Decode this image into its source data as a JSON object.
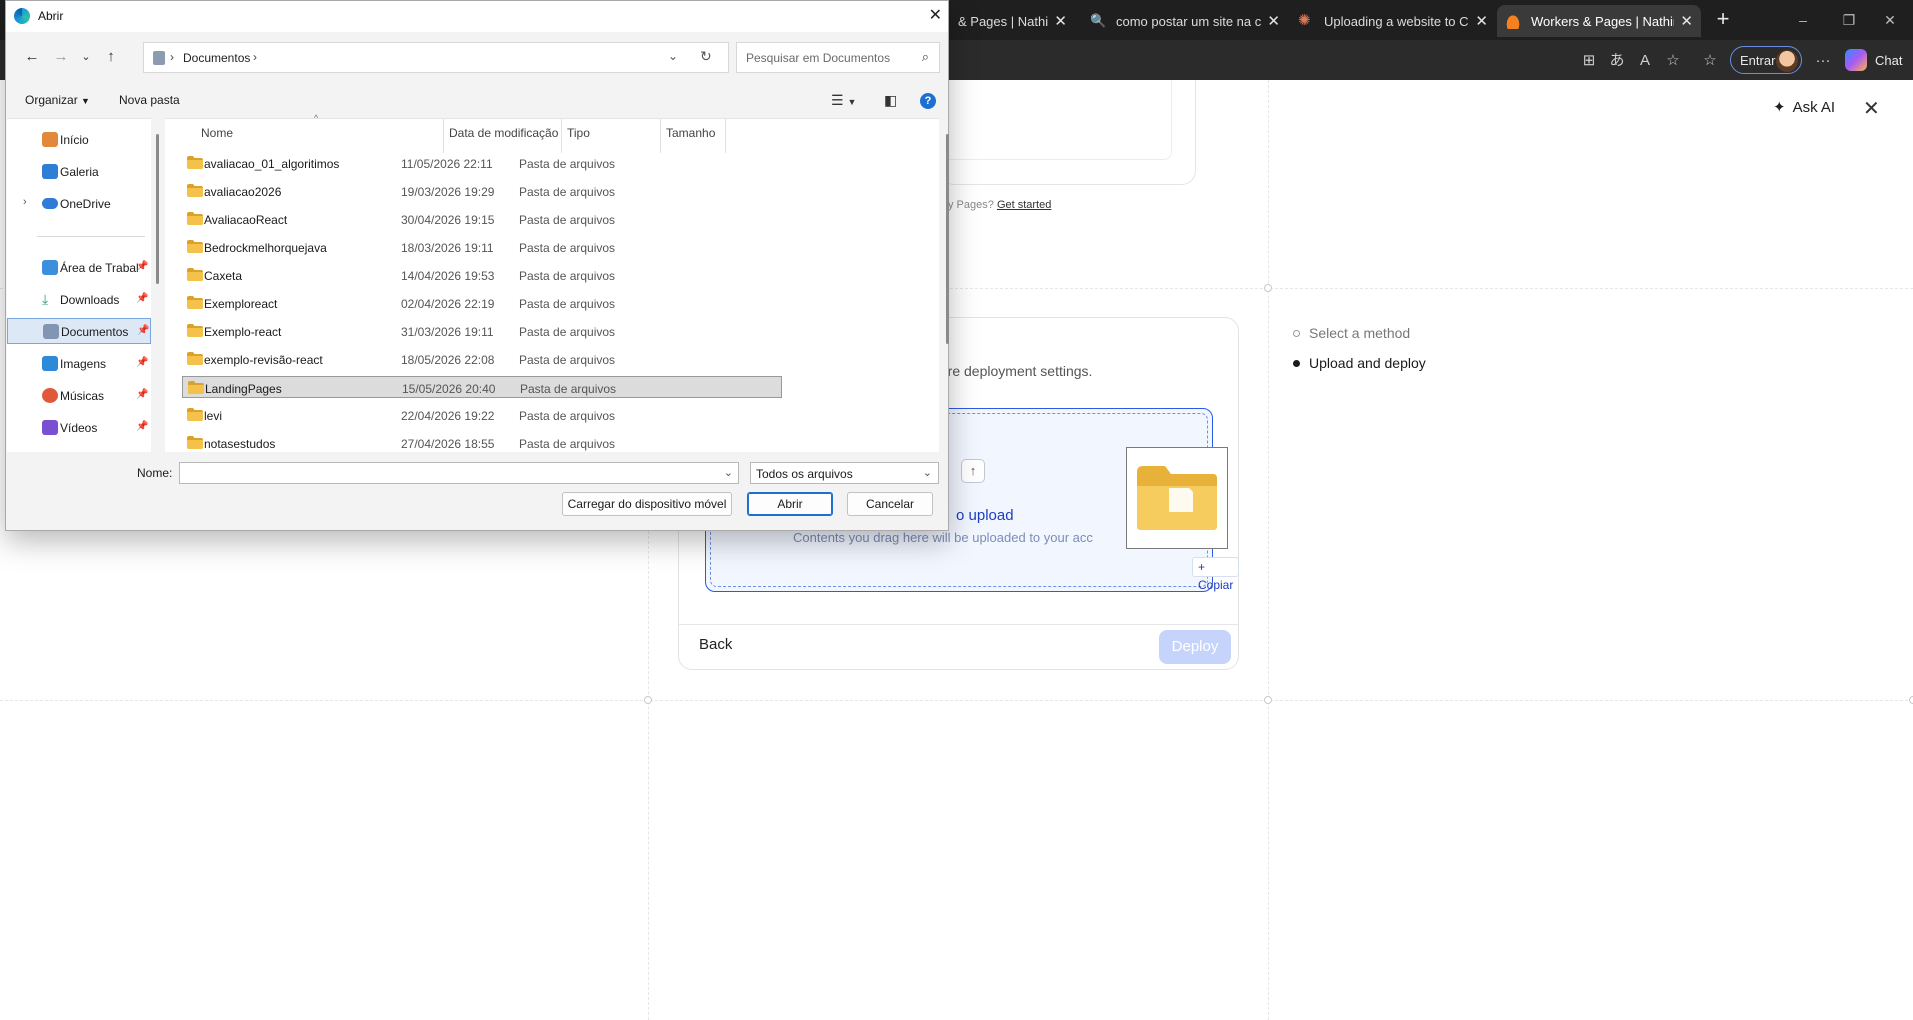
{
  "browser": {
    "tabs": [
      {
        "title": "& Pages | Nathiman",
        "active": false
      },
      {
        "title": "como postar um site na clou",
        "active": false
      },
      {
        "title": "Uploading a website to Clou",
        "active": false
      },
      {
        "title": "Workers & Pages | Nathiman",
        "active": true
      }
    ],
    "new_tab_icon": "plus-icon",
    "signin_label": "Entrar",
    "chat_label": "Chat",
    "more_label": "···"
  },
  "page": {
    "ask_ai_label": "Ask AI",
    "pages_note_prefix": "y Pages?",
    "pages_note_link": "Get started",
    "deploy_header_partial": "igure deployment settings.",
    "drop_title_partial": "o upload",
    "drop_subtitle": "Contents you drag here will be uploaded to your acc",
    "copy_badge": "+ Copiar",
    "back_label": "Back",
    "deploy_label": "Deploy",
    "steps": [
      {
        "label": "Select a method",
        "state": "pending"
      },
      {
        "label": "Upload and deploy",
        "state": "current"
      }
    ],
    "accent_color": "#1d3fbf"
  },
  "dialog": {
    "title": "Abrir",
    "path": "Documentos",
    "search_placeholder": "Pesquisar em Documentos",
    "organize_label": "Organizar",
    "new_folder_label": "Nova pasta",
    "columns": {
      "name": "Nome",
      "date": "Data de modificação",
      "type": "Tipo",
      "size": "Tamanho"
    },
    "nav": {
      "inicio": "Início",
      "galeria": "Galeria",
      "onedrive": "OneDrive",
      "desktop": "Área de Trabalho",
      "downloads": "Downloads",
      "documentos": "Documentos",
      "imagens": "Imagens",
      "musicas": "Músicas",
      "videos": "Vídeos"
    },
    "files": [
      {
        "name": "avaliacao_01_algoritimos",
        "date": "11/05/2026 22:11",
        "type": "Pasta de arquivos"
      },
      {
        "name": "avaliacao2026",
        "date": "19/03/2026 19:29",
        "type": "Pasta de arquivos"
      },
      {
        "name": "AvaliacaoReact",
        "date": "30/04/2026 19:15",
        "type": "Pasta de arquivos"
      },
      {
        "name": "Bedrockmelhorquejava",
        "date": "18/03/2026 19:11",
        "type": "Pasta de arquivos"
      },
      {
        "name": "Caxeta",
        "date": "14/04/2026 19:53",
        "type": "Pasta de arquivos"
      },
      {
        "name": "Exemploreact",
        "date": "02/04/2026 22:19",
        "type": "Pasta de arquivos"
      },
      {
        "name": "Exemplo-react",
        "date": "31/03/2026 19:11",
        "type": "Pasta de arquivos"
      },
      {
        "name": "exemplo-revisão-react",
        "date": "18/05/2026 22:08",
        "type": "Pasta de arquivos"
      },
      {
        "name": "LandingPages",
        "date": "15/05/2026 20:40",
        "type": "Pasta de arquivos",
        "selected": true
      },
      {
        "name": "levi",
        "date": "22/04/2026 19:22",
        "type": "Pasta de arquivos"
      },
      {
        "name": "notasestudos",
        "date": "27/04/2026 18:55",
        "type": "Pasta de arquivos"
      }
    ],
    "name_label": "Nome:",
    "name_value": "",
    "filter_value": "Todos os arquivos",
    "mobile_button": "Carregar do dispositivo móvel",
    "open_button": "Abrir",
    "cancel_button": "Cancelar",
    "folder_color": "#f4c24a"
  }
}
